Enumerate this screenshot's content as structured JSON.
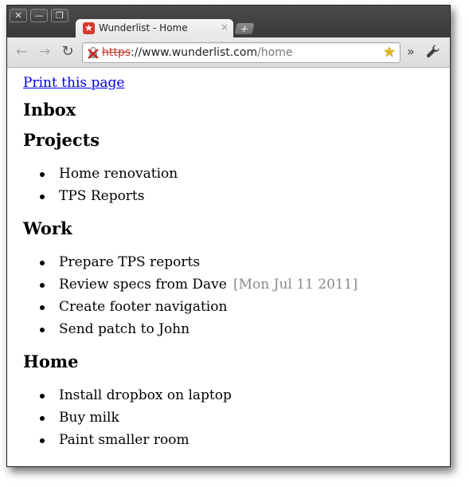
{
  "window": {
    "close_glyph": "✕",
    "min_glyph": "—",
    "max_glyph": "❐"
  },
  "tab": {
    "favicon_glyph": "★",
    "title": "Wunderlist - Home",
    "close_glyph": "×",
    "new_tab_glyph": "+"
  },
  "toolbar": {
    "back_glyph": "←",
    "forward_glyph": "→",
    "reload_glyph": "↻",
    "url_scheme": "https",
    "url_sep": "://",
    "url_host": "www.wunderlist.com",
    "url_path": "/home",
    "security_icon": "broken-lock-icon",
    "bookmark_glyph": "★",
    "overflow_glyph": "»",
    "wrench_glyph": "🔧"
  },
  "page": {
    "print_link": "Print this page",
    "sections": [
      {
        "title": "Inbox",
        "items": []
      },
      {
        "title": "Projects",
        "items": [
          {
            "text": "Home renovation",
            "due": ""
          },
          {
            "text": "TPS Reports",
            "due": ""
          }
        ]
      },
      {
        "title": "Work",
        "items": [
          {
            "text": "Prepare TPS reports",
            "due": ""
          },
          {
            "text": "Review specs from Dave",
            "due": "[Mon Jul 11 2011]"
          },
          {
            "text": "Create footer navigation",
            "due": ""
          },
          {
            "text": "Send patch to John",
            "due": ""
          }
        ]
      },
      {
        "title": "Home",
        "items": [
          {
            "text": "Install dropbox on laptop",
            "due": ""
          },
          {
            "text": "Buy milk",
            "due": ""
          },
          {
            "text": "Paint smaller room",
            "due": ""
          }
        ]
      }
    ]
  }
}
